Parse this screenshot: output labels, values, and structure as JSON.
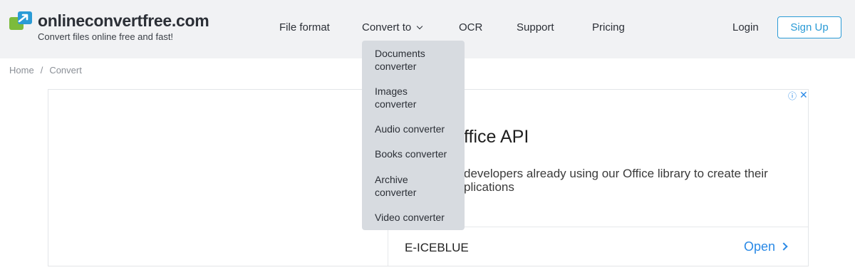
{
  "header": {
    "logo_title": "onlineconvertfree.com",
    "logo_subtitle": "Convert files online free and fast!",
    "nav": {
      "file_format": "File format",
      "convert_to": "Convert to",
      "ocr": "OCR",
      "support": "Support",
      "pricing": "Pricing"
    },
    "login": "Login",
    "signup": "Sign Up"
  },
  "breadcrumb": {
    "home": "Home",
    "separator": "/",
    "current": "Convert"
  },
  "dropdown": {
    "items": [
      {
        "label_line1": "Documents",
        "label_line2": "converter"
      },
      {
        "label_line1": "Images",
        "label_line2": "converter"
      },
      {
        "label_line1": "Audio converter",
        "label_line2": ""
      },
      {
        "label_line1": "Books converter",
        "label_line2": ""
      },
      {
        "label_line1": "Archive",
        "label_line2": "converter"
      },
      {
        "label_line1": "Video converter",
        "label_line2": ""
      }
    ]
  },
  "ad": {
    "title": "ffice API",
    "description": "developers already using our Office library to create their plications",
    "brand": "E-ICEBLUE",
    "open_label": "Open",
    "info_icon": "ⓘ",
    "close_icon": "✕"
  },
  "colors": {
    "header_bg": "#f1f2f4",
    "accent": "#2a9bd6",
    "ad_link": "#2a89e6",
    "dropdown_bg": "#d7dbe0"
  }
}
